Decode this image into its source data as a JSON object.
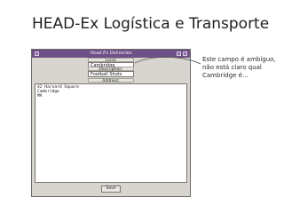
{
  "slide": {
    "title": "HEAD-Ex Logística e Transporte"
  },
  "window": {
    "title": "Head Ex Deliveries",
    "fields": [
      {
        "label": "Local:",
        "value": "Cambridge"
      },
      {
        "label": "Description:",
        "value": "Football Shots"
      }
    ],
    "address_label": "Address:",
    "address_lines": [
      "42 Harvard Square",
      "Cambridge",
      "MA"
    ],
    "save_label": "Save"
  },
  "annotation": {
    "lines": [
      "Este campo é ambíguo,",
      "não está claro qual",
      "Cambridge é..."
    ]
  }
}
